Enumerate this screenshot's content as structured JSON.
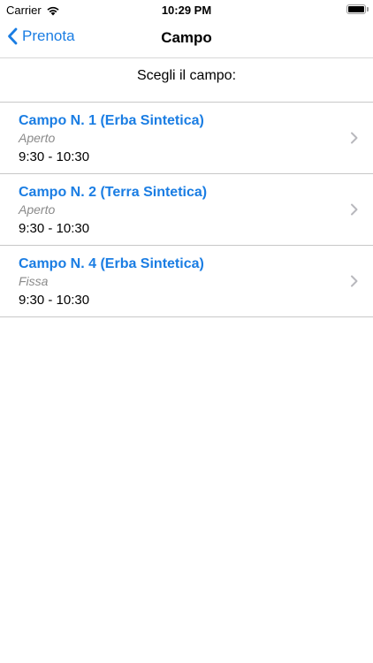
{
  "status_bar": {
    "carrier": "Carrier",
    "time": "10:29 PM"
  },
  "nav": {
    "back_label": "Prenota",
    "title": "Campo"
  },
  "header": {
    "text": "Scegli il campo:"
  },
  "fields": [
    {
      "title": "Campo N. 1 (Erba Sintetica)",
      "status": "Aperto",
      "time": "9:30 - 10:30"
    },
    {
      "title": "Campo N. 2 (Terra Sintetica)",
      "status": "Aperto",
      "time": "9:30 - 10:30"
    },
    {
      "title": "Campo N. 4 (Erba Sintetica)",
      "status": "Fissa",
      "time": "9:30 - 10:30"
    }
  ],
  "colors": {
    "accent": "#1a7de3",
    "secondary_text": "#8a8a8a",
    "separator": "#c8c8c8"
  },
  "icons": {
    "wifi": "wifi-icon",
    "battery": "battery-icon",
    "back": "chevron-left-icon",
    "row": "chevron-right-icon"
  }
}
